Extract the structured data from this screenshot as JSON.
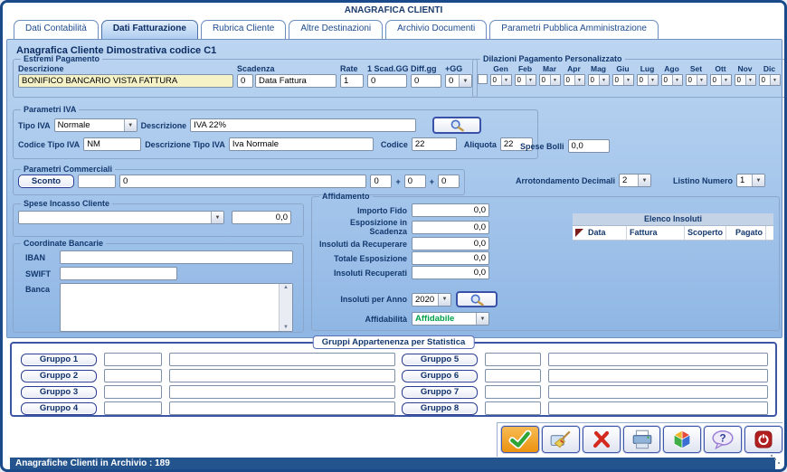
{
  "window": {
    "title": "ANAGRAFICA CLIENTI",
    "status": "Anagrafiche Clienti in Archivio :  189"
  },
  "tabs": [
    {
      "label": "Dati Contabilità"
    },
    {
      "label": "Dati Fatturazione"
    },
    {
      "label": "Rubrica Cliente"
    },
    {
      "label": "Altre Destinazioni"
    },
    {
      "label": "Archivio Documenti"
    },
    {
      "label": "Parametri Pubblica Amministrazione"
    }
  ],
  "page_title": "Anagrafica Cliente Dimostrativa codice C1",
  "icons": {
    "dropdown": "▼",
    "scroll_up": "▲",
    "scroll_down": "▼",
    "help": "?"
  },
  "estremi": {
    "legend": "Estremi Pagamento",
    "descrizione_label": "Descrizione",
    "descrizione_value": "BONIFICO BANCARIO VISTA FATTURA",
    "scadenza_label": "Scadenza",
    "scadenza_gg": "0",
    "scadenza_tipo": "Data Fattura",
    "rate_label": "Rate",
    "rate_value": "1",
    "scad1_label": "1 Scad.GG",
    "scad1_value": "0",
    "diff_label": "Diff.gg",
    "diff_value": "0",
    "piugg_label": "+GG",
    "piugg_value": "0"
  },
  "dilazioni": {
    "legend": "Dilazioni Pagamento Personalizzato",
    "months": [
      "Gen",
      "Feb",
      "Mar",
      "Apr",
      "Mag",
      "Giu",
      "Lug",
      "Ago",
      "Set",
      "Ott",
      "Nov",
      "Dic"
    ],
    "value": "0"
  },
  "iva": {
    "legend": "Parametri IVA",
    "tipo_label": "Tipo IVA",
    "tipo_value": "Normale",
    "descrizione_label": "Descrizione",
    "descrizione_value": "IVA 22%",
    "codice_tipo_label": "Codice Tipo IVA",
    "codice_tipo_value": "NM",
    "descr_tipo_label": "Descrizione Tipo IVA",
    "descr_tipo_value": "Iva Normale",
    "codice_label": "Codice",
    "codice_value": "22",
    "aliquota_label": "Aliquota",
    "aliquota_value": "22"
  },
  "spese_bolli": {
    "label": "Spese Bolli",
    "value": "0,0"
  },
  "commerciali": {
    "legend": "Parametri Commerciali",
    "sconto": "Sconto",
    "campo1": "",
    "campo2": "0",
    "campo3": "0",
    "campo4": "0",
    "campo5": "0",
    "plus": "+"
  },
  "arrotondamento": {
    "label": "Arrotondamento Decimali",
    "value": "2"
  },
  "listino": {
    "label": "Listino Numero",
    "value": "1"
  },
  "spese_incasso": {
    "legend": "Spese Incasso Cliente",
    "combo": "",
    "importo": "0,0"
  },
  "coordinate": {
    "legend": "Coordinate Bancarie",
    "iban": "IBAN",
    "swift": "SWIFT",
    "banca": "Banca"
  },
  "affidamento": {
    "legend": "Affidamento",
    "rows": [
      {
        "label": "Importo Fido",
        "value": "0,0"
      },
      {
        "label": "Esposizione in Scadenza",
        "value": "0,0"
      },
      {
        "label": "Insoluti da Recuperare",
        "value": "0,0"
      },
      {
        "label": "Totale Esposizione",
        "value": "0,0"
      },
      {
        "label": "Insoluti Recuperati",
        "value": "0,0"
      }
    ],
    "anno_label": "Insoluti per Anno",
    "anno": "2020",
    "affidabilita_label": "Affidabilità",
    "affidabilita": "Affidabile"
  },
  "elenco": {
    "title": "Elenco Insoluti",
    "columns": [
      "Data",
      "Fattura",
      "Scoperto",
      "Pagato"
    ]
  },
  "stats": {
    "title": "Gruppi Appartenenza per Statistica",
    "groups": [
      "Gruppo 1",
      "Gruppo 2",
      "Gruppo 3",
      "Gruppo 4",
      "Gruppo 5",
      "Gruppo 6",
      "Gruppo 7",
      "Gruppo 8"
    ]
  },
  "colors": {
    "window_border": "#1b4a8a",
    "panel_top": "#bcd5f1",
    "panel_bottom": "#8fb6e4",
    "highlight_field": "#f6f2c8",
    "affidabile_green": "#00a14b",
    "statusbar_blue": "#24548e",
    "confirm_orange": "#ec920f",
    "delete_red": "#d42a1e",
    "exit_red": "#b21f1f"
  }
}
